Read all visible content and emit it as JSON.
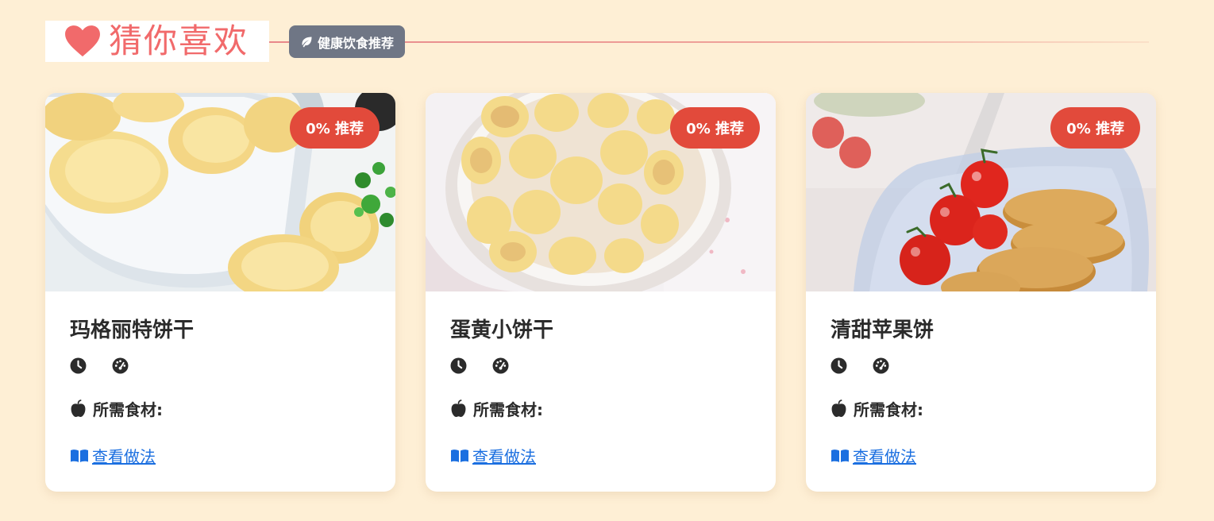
{
  "header": {
    "title": "猜你喜欢",
    "tag_label": "健康饮食推荐",
    "heart_icon": "heart-icon",
    "leaf_icon": "leaf-icon",
    "accent_color": "#F16A6B"
  },
  "cards": [
    {
      "title": "玛格丽特饼干",
      "recommend": "0% 推荐",
      "ingredients_label": "所需食材:",
      "link_label": " 查看做法",
      "image": "margherita-cookies-photo"
    },
    {
      "title": "蛋黄小饼干",
      "recommend": "0% 推荐",
      "ingredients_label": "所需食材:",
      "link_label": " 查看做法",
      "image": "egg-yolk-biscuits-photo"
    },
    {
      "title": "清甜苹果饼",
      "recommend": "0% 推荐",
      "ingredients_label": "所需食材:",
      "link_label": " 查看做法",
      "image": "apple-cakes-photo"
    }
  ],
  "icons": {
    "time": "clock-icon",
    "difficulty": "gauge-icon",
    "ingredients": "apple-icon",
    "link": "book-open-icon"
  },
  "colors": {
    "badge_red": "#E24A3B",
    "link_blue": "#1B6FE0",
    "background": "#FEEFD5",
    "tag_gray": "#6F7685"
  }
}
